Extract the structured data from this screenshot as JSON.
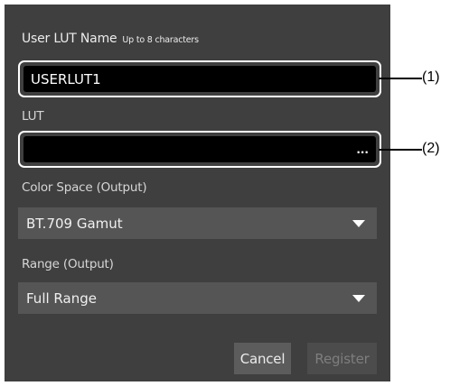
{
  "dialog": {
    "title": "User LUT Name",
    "title_hint": "Up to 8 characters",
    "name_field": {
      "value": "USERLUT1"
    },
    "lut_label": "LUT",
    "lut_field": {
      "value": "",
      "browse_label": "..."
    },
    "color_space": {
      "label": "Color Space (Output)",
      "selected": "BT.709 Gamut"
    },
    "range": {
      "label": "Range (Output)",
      "selected": "Full Range"
    },
    "buttons": {
      "cancel": "Cancel",
      "register": "Register"
    }
  },
  "callouts": [
    "(1)",
    "(2)"
  ],
  "colors": {
    "dialog_bg": "#3f3f3f",
    "field_bg": "#000000",
    "select_bg": "#555555",
    "callout_border": "#ffffff",
    "disabled_text": "#7e7e7e"
  },
  "icons": {
    "dropdown": "chevron-down-icon",
    "browse": "ellipsis-icon"
  }
}
